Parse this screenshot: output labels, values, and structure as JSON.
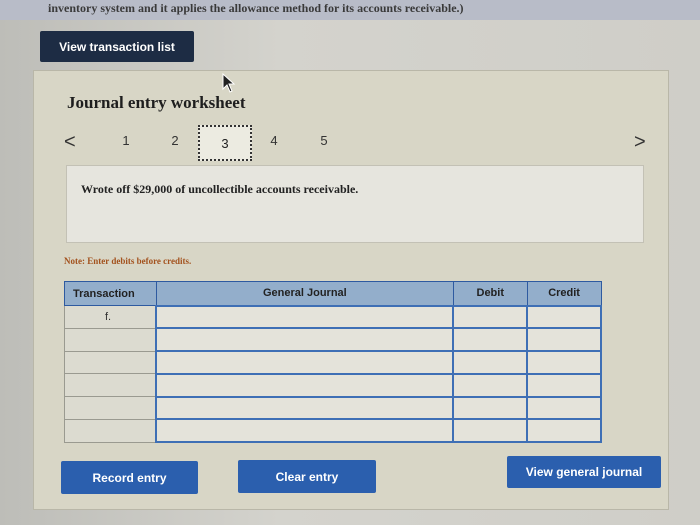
{
  "header": {
    "instruction_tail": "inventory system and it applies the allowance method for its accounts receivable.)"
  },
  "buttons": {
    "view_transaction_list": "View transaction list",
    "record_entry": "Record entry",
    "clear_entry": "Clear entry",
    "view_general_journal": "View general journal"
  },
  "worksheet": {
    "title": "Journal entry worksheet",
    "pager": {
      "prev": "<",
      "next": ">",
      "pages": [
        "1",
        "2",
        "3",
        "4",
        "5"
      ],
      "active_page": "3"
    },
    "description": "Wrote off $29,000 of uncollectible accounts receivable.",
    "note": "Note: Enter debits before credits."
  },
  "journal_table": {
    "columns": [
      "Transaction",
      "General Journal",
      "Debit",
      "Credit"
    ],
    "rows": [
      {
        "transaction": "f.",
        "account": "",
        "debit": "",
        "credit": ""
      },
      {
        "transaction": "",
        "account": "",
        "debit": "",
        "credit": ""
      },
      {
        "transaction": "",
        "account": "",
        "debit": "",
        "credit": ""
      },
      {
        "transaction": "",
        "account": "",
        "debit": "",
        "credit": ""
      },
      {
        "transaction": "",
        "account": "",
        "debit": "",
        "credit": ""
      },
      {
        "transaction": "",
        "account": "",
        "debit": "",
        "credit": ""
      }
    ]
  },
  "colors": {
    "header_button_dark": "#1d2c44",
    "action_button_blue": "#2b5fae",
    "table_header_blue": "#93aecb",
    "note_text": "#a3521e"
  }
}
